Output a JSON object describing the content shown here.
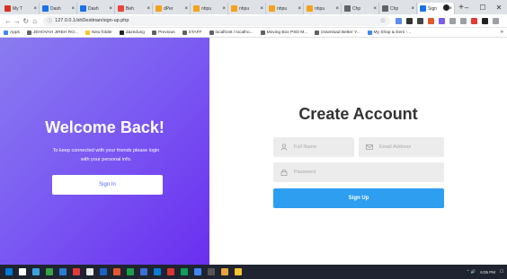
{
  "browser": {
    "tabs": [
      {
        "label": "My T",
        "fav": "#d93025"
      },
      {
        "label": "Dash",
        "fav": "#1a73e8"
      },
      {
        "label": "Dash",
        "fav": "#1a73e8"
      },
      {
        "label": "Beh",
        "fav": "#e8453c"
      },
      {
        "label": "dPer",
        "fav": "#f4a21b"
      },
      {
        "label": "nhpu",
        "fav": "#f4a21b"
      },
      {
        "label": "nhpu",
        "fav": "#f4a21b"
      },
      {
        "label": "nhpu",
        "fav": "#f4a21b"
      },
      {
        "label": "nhpu",
        "fav": "#f4a21b"
      },
      {
        "label": "Chp",
        "fav": "#5f6368"
      },
      {
        "label": "Chp",
        "fav": "#5f6368"
      },
      {
        "label": "Sign",
        "fav": "#1a73e8"
      }
    ],
    "tab_close": "×",
    "new_tab": "+",
    "window_controls": {
      "minimize": "–",
      "maximize": "☐",
      "close": "✕"
    },
    "url": "127.0.0.1/shDestinan/sign-up.php",
    "bookmarks": [
      {
        "label": "Apps",
        "color": "#4285f4"
      },
      {
        "label": "JEHOVAH JIREH RO...",
        "color": "#5f6368"
      },
      {
        "label": "New folder",
        "color": "#f4c430"
      },
      {
        "label": "dazedung",
        "color": "#222"
      },
      {
        "label": "Previous",
        "color": "#5f6368"
      },
      {
        "label": "STAFF",
        "color": "#5f6368"
      },
      {
        "label": "localhost / localho...",
        "color": "#5f6368"
      },
      {
        "label": "Moving Box PSD M...",
        "color": "#5f6368"
      },
      {
        "label": "Download Better Y...",
        "color": "#5f6368"
      },
      {
        "label": "My Shop & Eem -...",
        "color": "#4285f4"
      }
    ],
    "bookmarks_more": "»"
  },
  "overlay": {
    "title": "Welcome Back!",
    "text": "To keep connected with your friends please login with your personal info.",
    "button": "Sign In"
  },
  "form": {
    "title": "Create Account",
    "name_placeholder": "Full Name",
    "email_placeholder": "Email Address",
    "password_placeholder": "Password",
    "button": "Sign Up"
  },
  "colors": {
    "gradient_start": "#8a7cf0",
    "gradient_end": "#6a2ef0",
    "signup_button": "#2d9ef0",
    "signin_text": "#4a6cf7"
  },
  "taskbar": {
    "icons": [
      "#0078d7",
      "#ffffff",
      "#3aa0e0",
      "#38a34a",
      "#2b7cd3",
      "#e23a3a",
      "#e8e8e8",
      "#1e63c4",
      "#e2572b",
      "#1e9e4a",
      "#3b6fd6",
      "#0a7bd7",
      "#d9352f",
      "#0f9d58",
      "#4285f4",
      "#555",
      "#e8a33a",
      "#f4c430"
    ],
    "time": "6:05 PM",
    "tray_icons": "⌃ 🔊"
  }
}
